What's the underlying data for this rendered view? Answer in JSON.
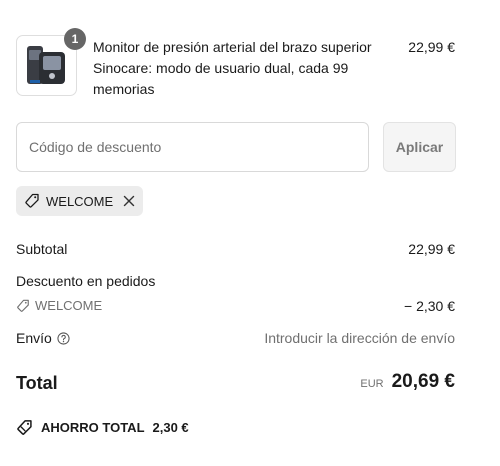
{
  "line_item": {
    "quantity": "1",
    "title": "Monitor de presión arterial del brazo superior Sinocare: modo de usuario dual, cada 99 memorias",
    "price": "22,99 €"
  },
  "discount": {
    "placeholder": "Código de descuento",
    "value": "",
    "apply_label": "Aplicar",
    "applied_code": "WELCOME"
  },
  "summary": {
    "subtotal_label": "Subtotal",
    "subtotal_value": "22,99 €",
    "order_discount_label": "Descuento en pedidos",
    "discount_code": "WELCOME",
    "discount_value": "− 2,30 €",
    "shipping_label": "Envío",
    "shipping_value": "Introducir la dirección de envío",
    "total_label": "Total",
    "currency": "EUR",
    "total_value": "20,69 €",
    "savings_label": "AHORRO TOTAL",
    "savings_value": "2,30 €"
  },
  "icons": {
    "tag": "tag-icon",
    "close": "close-icon",
    "help": "help-circle-icon",
    "savings": "savings-tag-icon"
  },
  "colors": {
    "badge": "#666666",
    "muted_text": "#707070",
    "chip_bg": "#ececec"
  }
}
